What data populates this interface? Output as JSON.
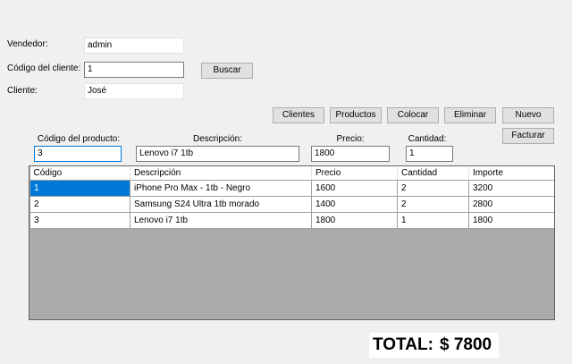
{
  "header": {
    "vendedor_label": "Vendedor:",
    "vendedor_value": "admin",
    "codigo_cliente_label": "Código del cliente:",
    "codigo_cliente_value": "1",
    "buscar_label": "Buscar",
    "cliente_label": "Cliente:",
    "cliente_value": "José"
  },
  "toolbar": {
    "clientes": "Clientes",
    "productos": "Productos",
    "colocar": "Colocar",
    "eliminar": "Eliminar",
    "nuevo": "Nuevo",
    "facturar": "Facturar"
  },
  "product_entry": {
    "codigo_label": "Código del producto:",
    "codigo_value": "3",
    "descripcion_label": "Descripción:",
    "descripcion_value": "Lenovo i7 1tb",
    "precio_label": "Precio:",
    "precio_value": "1800",
    "cantidad_label": "Cantidad:",
    "cantidad_value": "1"
  },
  "table": {
    "columns": [
      "Código",
      "Descripción",
      "Precio",
      "Cantidad",
      "Importe"
    ],
    "rows": [
      [
        "1",
        "iPhone Pro Max - 1tb - Negro",
        "1600",
        "2",
        "3200"
      ],
      [
        "2",
        "Samsung S24 Ultra 1tb morado",
        "1400",
        "2",
        "2800"
      ],
      [
        "3",
        "Lenovo i7 1tb",
        "1800",
        "1",
        "1800"
      ]
    ],
    "selected_cell_color": "#0078d7"
  },
  "totals": {
    "label": "TOTAL:",
    "value": "$ 7800"
  }
}
